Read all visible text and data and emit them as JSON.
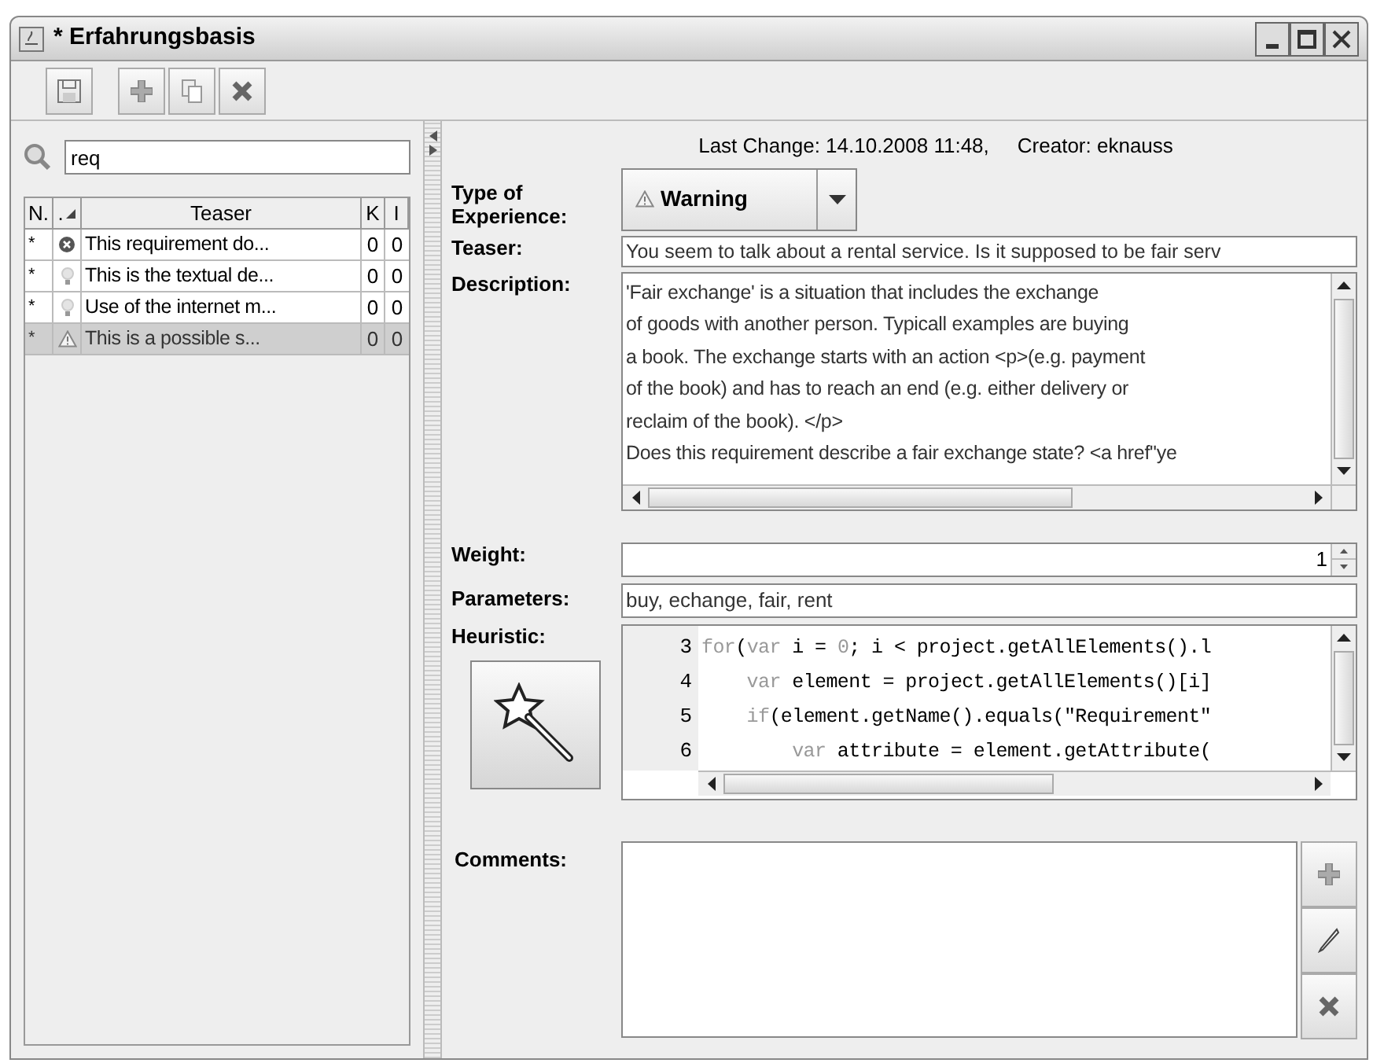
{
  "window": {
    "title": "* Erfahrungsbasis"
  },
  "search": {
    "value": "req"
  },
  "table": {
    "columns": [
      "N.",
      ".",
      "Teaser",
      "K",
      "I"
    ],
    "rows": [
      {
        "n": "*",
        "kind": "error",
        "teaser": "This requirement do...",
        "k": "0",
        "i": "0",
        "selected": false
      },
      {
        "n": "*",
        "kind": "bulb",
        "teaser": "This is the textual de...",
        "k": "0",
        "i": "0",
        "selected": false
      },
      {
        "n": "*",
        "kind": "bulb",
        "teaser": "Use of the internet m...",
        "k": "0",
        "i": "0",
        "selected": false
      },
      {
        "n": "*",
        "kind": "warning",
        "teaser": "This is a possible s...",
        "k": "0",
        "i": "0",
        "selected": true
      }
    ]
  },
  "details": {
    "last_change": "Last Change: 14.10.2008 11:48,",
    "creator": "Creator: eknauss",
    "type_label": "Type of Experience:",
    "type_value": "Warning",
    "teaser_label": "Teaser:",
    "teaser": "You seem to talk about a rental service. Is it supposed to be fair serv",
    "description_label": "Description:",
    "description": [
      "'Fair exchange' is a situation that includes the exchange",
      "of goods with another person. Typicall examples are buying",
      "a book. The exchange starts with an action <p>(e.g. payment",
      "of the book) and has to reach an end (e.g. either delivery or",
      "reclaim of the book). </p>",
      "Does this requirement describe a fair exchange state? <a href\"ye"
    ],
    "weight_label": "Weight:",
    "weight": "1",
    "parameters_label": "Parameters:",
    "parameters": "buy, echange, fair, rent",
    "heuristic_label": "Heuristic:",
    "code": [
      {
        "number": "3",
        "tokens": [
          {
            "kind": "keyword",
            "text": "for"
          },
          {
            "kind": "plain",
            "text": "("
          },
          {
            "kind": "keyword",
            "text": "var"
          },
          {
            "kind": "plain",
            "text": " i = "
          },
          {
            "kind": "keyword",
            "text": "0"
          },
          {
            "kind": "plain",
            "text": "; i < project.getAllElements().l"
          }
        ]
      },
      {
        "number": "4",
        "tokens": [
          {
            "kind": "keyword",
            "text": "    var"
          },
          {
            "kind": "plain",
            "text": " element = project.getAllElements()[i]"
          }
        ]
      },
      {
        "number": "5",
        "tokens": [
          {
            "kind": "keyword",
            "text": "    if"
          },
          {
            "kind": "plain",
            "text": "(element.getName().equals(\"Requirement\""
          }
        ]
      },
      {
        "number": "6",
        "tokens": [
          {
            "kind": "keyword",
            "text": "        var"
          },
          {
            "kind": "plain",
            "text": " attribute = element.getAttribute("
          }
        ]
      }
    ],
    "comments_label": "Comments:"
  }
}
